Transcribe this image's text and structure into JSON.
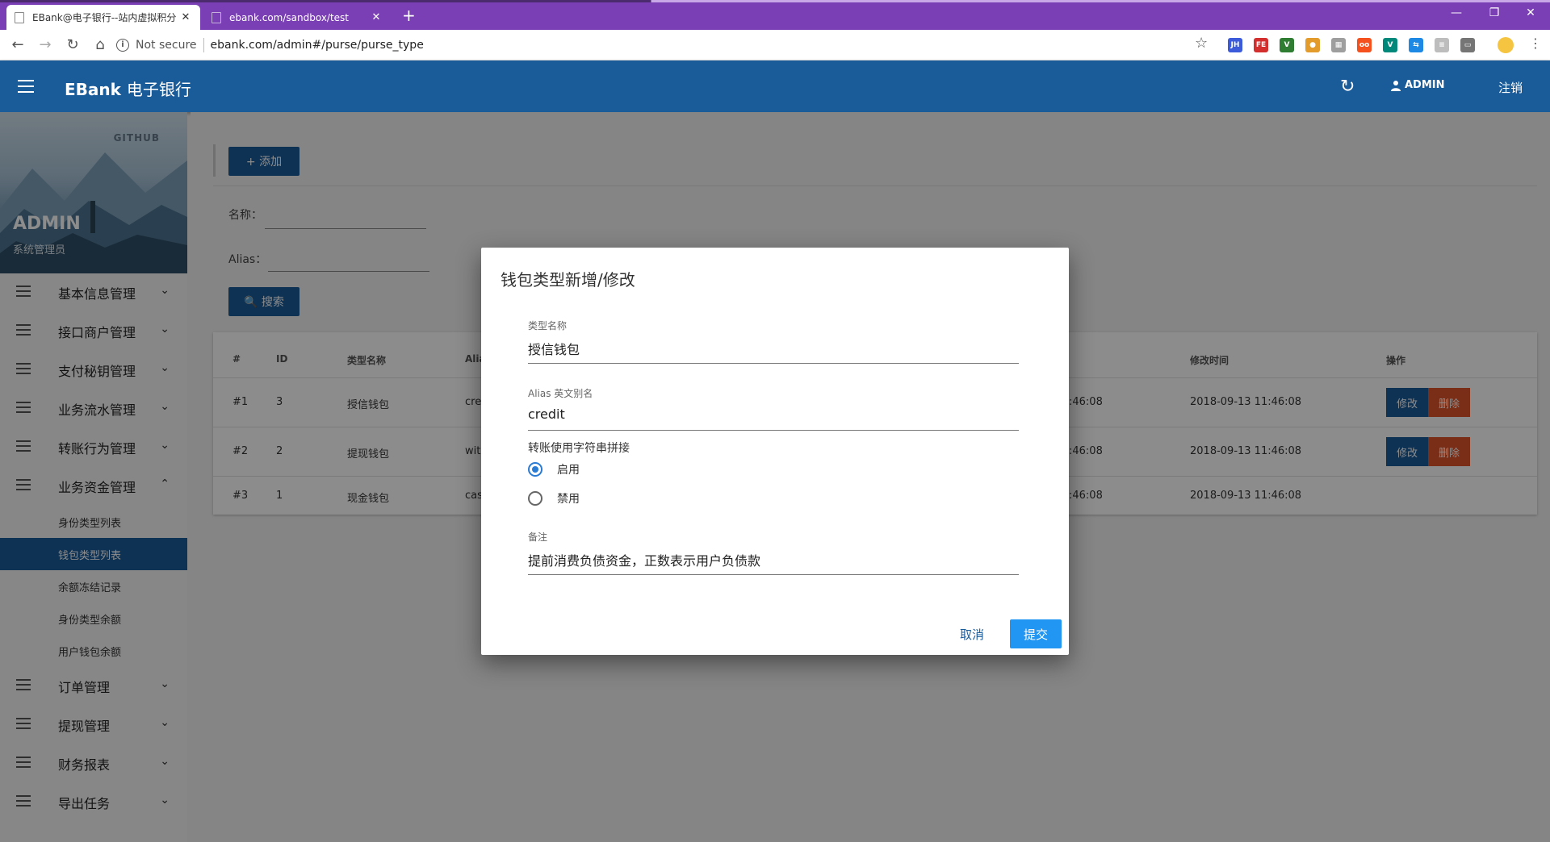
{
  "browser": {
    "tabs": [
      {
        "title": "EBank@电子银行--站内虚拟积分",
        "close": "✕"
      },
      {
        "title": "ebank.com/sandbox/test",
        "close": "✕"
      }
    ],
    "new_tab": "+",
    "not_secure": "Not secure",
    "url": "ebank.com/admin#/purse/purse_type",
    "window_controls": [
      "—",
      "❐",
      "✕"
    ],
    "extensions": [
      {
        "name": "jh-icon",
        "label": "JH",
        "color": "#3b5bdb"
      },
      {
        "name": "fe-icon",
        "label": "FE",
        "color": "#d32f2f"
      },
      {
        "name": "vue-icon",
        "label": "V",
        "color": "#2e7d32"
      },
      {
        "name": "cookie-icon",
        "label": "●",
        "color": "#e39b2b"
      },
      {
        "name": "grid-icon",
        "label": "▦",
        "color": "#9e9e9e"
      },
      {
        "name": "oo-icon",
        "label": "oo",
        "color": "#f4511e"
      },
      {
        "name": "vue2-icon",
        "label": "V",
        "color": "#00897b"
      },
      {
        "name": "translate-icon",
        "label": "⇆",
        "color": "#1e88e5"
      },
      {
        "name": "list-icon",
        "label": "≡",
        "color": "#bdbdbd"
      },
      {
        "name": "window-icon",
        "label": "▭",
        "color": "#757575"
      }
    ]
  },
  "header": {
    "brand_main": "EBank",
    "brand_cn": "电子银行",
    "user": "ADMIN",
    "logout": "注销"
  },
  "sidebar": {
    "github": "GITHUB",
    "name": "ADMIN",
    "role": "系统管理员",
    "menu": [
      {
        "label": "基本信息管理",
        "chevron": "⌄"
      },
      {
        "label": "接口商户管理",
        "chevron": "⌄"
      },
      {
        "label": "支付秘钥管理",
        "chevron": "⌄"
      },
      {
        "label": "业务流水管理",
        "chevron": "⌄"
      },
      {
        "label": "转账行为管理",
        "chevron": "⌄"
      },
      {
        "label": "业务资金管理",
        "chevron": "⌃"
      }
    ],
    "submenu": [
      "身份类型列表",
      "钱包类型列表",
      "余额冻结记录",
      "身份类型余额",
      "用户钱包余额"
    ],
    "menu_after": [
      {
        "label": "订单管理",
        "chevron": "⌄"
      },
      {
        "label": "提现管理",
        "chevron": "⌄"
      },
      {
        "label": "财务报表",
        "chevron": "⌄"
      },
      {
        "label": "导出任务",
        "chevron": "⌄"
      }
    ]
  },
  "main": {
    "add_label": "+ 添加",
    "filter_name": "名称：",
    "filter_alias": "Alias：",
    "search_label": "🔍 搜索",
    "table": {
      "headers": [
        "#",
        "ID",
        "类型名称",
        "Alia",
        "修改时间",
        "操作"
      ],
      "rows": [
        {
          "idx": "#1",
          "id": "3",
          "name": "授信钱包",
          "alias": "cre",
          "created": ":46:08",
          "modified": "2018-09-13 11:46:08",
          "edit": "修改",
          "del": "删除"
        },
        {
          "idx": "#2",
          "id": "2",
          "name": "提现钱包",
          "alias": "wit",
          "created": ":46:08",
          "modified": "2018-09-13 11:46:08",
          "edit": "修改",
          "del": "删除"
        },
        {
          "idx": "#3",
          "id": "1",
          "name": "现金钱包",
          "alias": "cas",
          "created": ":46:08",
          "modified": "2018-09-13 11:46:08"
        }
      ]
    }
  },
  "dialog": {
    "title": "钱包类型新增/修改",
    "type_name_label": "类型名称",
    "type_name_value": "授信钱包",
    "alias_label": "Alias 英文别名",
    "alias_value": "credit",
    "transfer_legend": "转账使用字符串拼接",
    "radio_enable": "启用",
    "radio_disable": "禁用",
    "remark_label": "备注",
    "remark_value": "提前消费负债资金，正数表示用户负债款",
    "cancel": "取消",
    "submit": "提交"
  }
}
